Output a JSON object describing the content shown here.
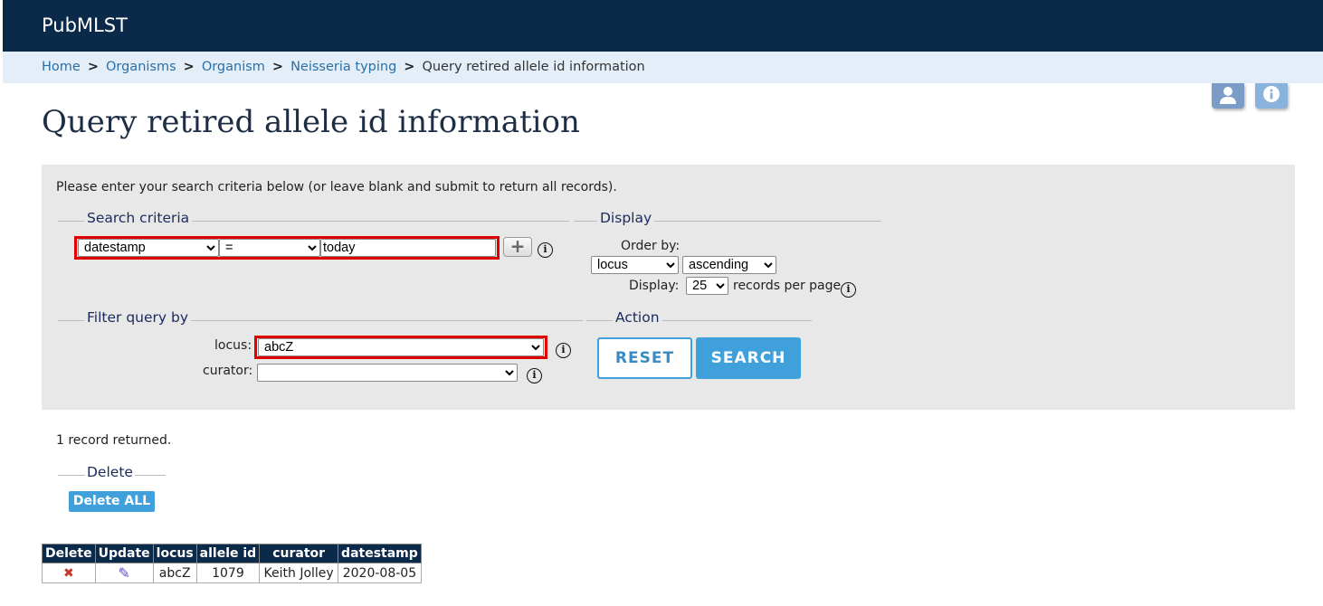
{
  "header": {
    "brand": "PubMLST"
  },
  "breadcrumb": {
    "items": [
      "Home",
      "Organisms",
      "Organism",
      "Neisseria typing"
    ],
    "current": "Query retired allele id information",
    "separator": ">"
  },
  "page": {
    "title": "Query retired allele id information"
  },
  "form": {
    "intro": "Please enter your search criteria below (or leave blank and submit to return all records).",
    "search_criteria": {
      "legend": "Search criteria",
      "field_value": "datestamp",
      "operator_value": "=",
      "term_value": "today"
    },
    "display": {
      "legend": "Display",
      "order_by_label": "Order by:",
      "order_field_value": "locus",
      "order_direction_value": "ascending",
      "display_label": "Display:",
      "per_page_value": "25",
      "per_page_suffix": "records per page"
    },
    "filter": {
      "legend": "Filter query by",
      "locus_label": "locus:",
      "locus_value": "abcZ",
      "curator_label": "curator:",
      "curator_value": ""
    },
    "action": {
      "legend": "Action",
      "reset_label": "RESET",
      "search_label": "SEARCH"
    },
    "info_glyph": "i",
    "plus_glyph": "+"
  },
  "results": {
    "count_text": "1 record returned.",
    "delete_legend": "Delete",
    "delete_all_label": "Delete ALL",
    "columns": [
      "Delete",
      "Update",
      "locus",
      "allele id",
      "curator",
      "datestamp"
    ],
    "rows": [
      {
        "delete_icon": "✖",
        "update_icon": "✎",
        "locus": "abcZ",
        "allele_id": "1079",
        "curator": "Keith Jolley",
        "datestamp": "2020-08-05"
      }
    ]
  },
  "colors": {
    "header_bg": "#0b2a4a",
    "breadcrumb_bg": "#e4eef8",
    "panel_bg": "#e8e8e8",
    "accent": "#3fa0dc",
    "highlight": "#e00000",
    "delete_icon": "#c0392b",
    "update_icon": "#5b4fc4"
  },
  "icons": {
    "user": "user-icon",
    "info": "info-icon"
  }
}
